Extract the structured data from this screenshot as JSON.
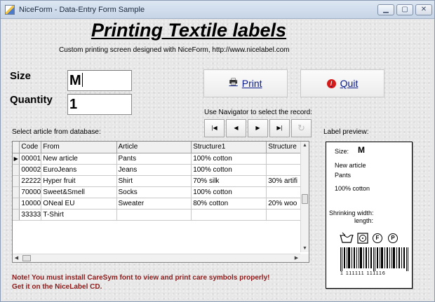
{
  "window": {
    "title": "NiceForm - Data-Entry Form Sample",
    "controls": {
      "minimize": "▁",
      "maximize": "▢",
      "close": "✕"
    }
  },
  "header": {
    "title": "Printing Textile labels",
    "subtitle": "Custom printing screen designed with NiceForm, http://www.nicelabel.com"
  },
  "form": {
    "size_label": "Size",
    "size_value": "M",
    "quantity_label": "Quantity",
    "quantity_value": "1"
  },
  "buttons": {
    "print_label": "Print",
    "print_icon": "printer-icon",
    "quit_label": "Quit",
    "quit_icon": "stop-icon"
  },
  "navigator": {
    "caption": "Use Navigator to select the record:",
    "first": "|◀",
    "prior": "◀",
    "next": "▶",
    "last": "▶|",
    "refresh": "↻"
  },
  "grid": {
    "caption": "Select article from database:",
    "columns": [
      "Code",
      "From",
      "Article",
      "Structure1",
      "Structure"
    ],
    "rows": [
      [
        "00001",
        "New article",
        "Pants",
        "100% cotton",
        ""
      ],
      [
        "00002",
        "EuroJeans",
        "Jeans",
        "100% cotton",
        ""
      ],
      [
        "22222",
        "Hyper fruit",
        "Shirt",
        "70% silk",
        "30% artifi"
      ],
      [
        "70000",
        "Sweet&Smell",
        "Socks",
        "100% cotton",
        ""
      ],
      [
        "10000",
        "ONeal EU",
        "Sweater",
        "80% cotton",
        "20% woo"
      ],
      [
        "33333",
        "T-Shirt",
        "",
        "",
        ""
      ]
    ],
    "current_row_marker": "▶"
  },
  "note": {
    "line1": "Note! You must install CareSym font to view and print care symbols properly!",
    "line2": "Get it on the NiceLabel CD."
  },
  "preview": {
    "caption": "Label preview:",
    "size_label": "Size:",
    "size_value": "M",
    "article_from": "New article",
    "article": "Pants",
    "structure": "100% cotton",
    "shrinking_label": "Shrinking width:",
    "length_label": "length:",
    "care_symbols": [
      "F",
      "P"
    ],
    "barcode_text": "1  111111  111116"
  },
  "colors": {
    "note_text": "#8b1a1a",
    "button_text": "#0a1a8a",
    "quit_icon": "#d51a1a"
  }
}
